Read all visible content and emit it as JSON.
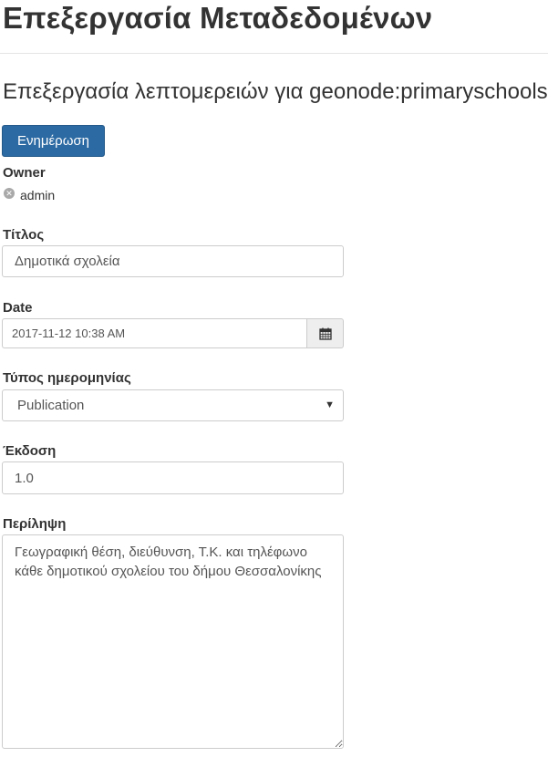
{
  "page": {
    "title": "Επεξεργασία Μεταδεδομένων",
    "subtitle": "Επεξεργασία λεπτομερειών για geonode:primaryschools"
  },
  "actions": {
    "update_label": "Ενημέρωση"
  },
  "owner": {
    "label": "Owner",
    "value": "admin"
  },
  "fields": {
    "title": {
      "label": "Τίτλος",
      "value": "Δημοτικά σχολεία"
    },
    "date": {
      "label": "Date",
      "value": "2017-11-12 10:38 AM",
      "icon": "calendar-icon"
    },
    "date_type": {
      "label": "Τύπος ημερομηνίας",
      "selected": "Publication"
    },
    "edition": {
      "label": "Έκδοση",
      "value": "1.0"
    },
    "abstract": {
      "label": "Περίληψη",
      "value": "Γεωγραφική θέση, διεύθυνση, Τ.Κ. και τηλέφωνο κάθε δημοτικού σχολείου του δήμου Θεσσαλονίκης"
    }
  },
  "colors": {
    "primary": "#2c6aa3",
    "border": "#cccccc",
    "addon_bg": "#eeeeee",
    "text": "#333333"
  }
}
